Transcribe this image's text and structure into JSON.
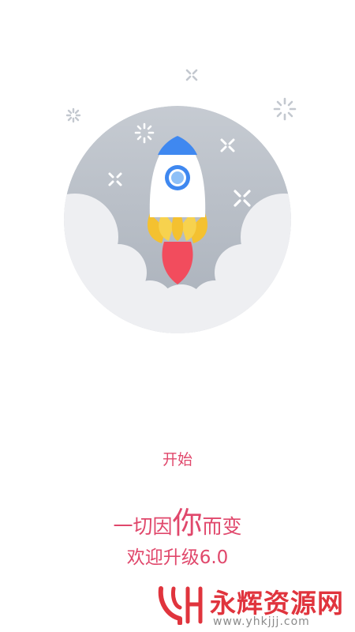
{
  "start_label": "开始",
  "slogan": {
    "line1_pre": "一切因",
    "line1_emph": "你",
    "line1_post": "而变",
    "line2": "欢迎升级6.0"
  },
  "watermark": {
    "name": "永辉资源网",
    "url": "www.yhkjjj.com",
    "logo_text": "YH"
  },
  "colors": {
    "accent": "#e0476b",
    "circle": "#b7bdc6",
    "cloud": "#eeeff2",
    "rocket_body": "#ffffff",
    "rocket_nose": "#3f88f0",
    "flame_outer": "#f4c130",
    "flame_inner": "#f24c5d"
  },
  "icons": [
    "rocket-icon",
    "sparkle-icon",
    "star-cross-icon",
    "cloud-shape"
  ]
}
